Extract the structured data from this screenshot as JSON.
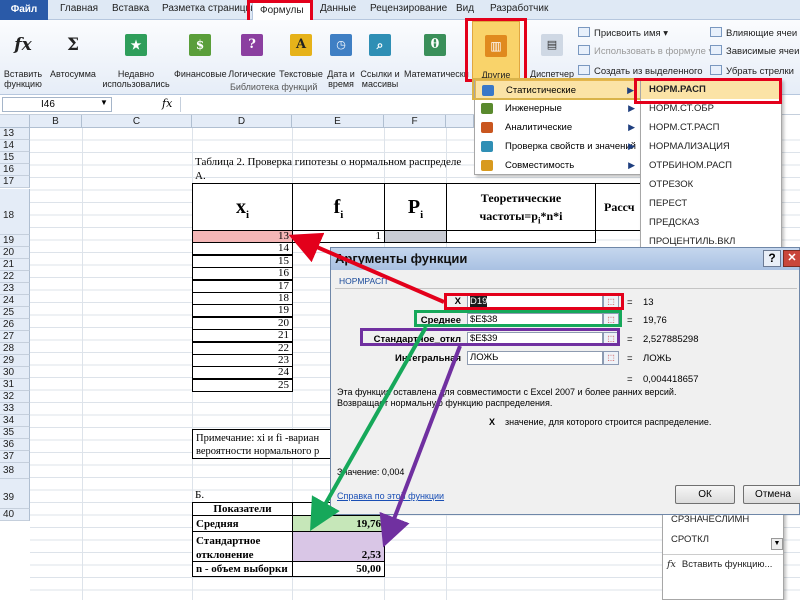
{
  "colors": {
    "accent_red": "#e3001b",
    "accent_green": "#16a85a",
    "accent_purple": "#7030a0",
    "file_tab": "#2a5aa8",
    "ribbon_bg": "#e6edf7"
  },
  "tabs": {
    "file": "Файл",
    "home": "Главная",
    "insert": "Вставка",
    "layout": "Разметка страницы",
    "formulas": "Формулы",
    "data": "Данные",
    "review": "Рецензирование",
    "view": "Вид",
    "developer": "Разработчик"
  },
  "ribbon": {
    "insert_function": "Вставить\nфункцию",
    "autosum": "Автосумма",
    "recent": "Недавно\nиспользовались",
    "financial": "Финансовые",
    "logical": "Логические",
    "text": "Текстовые",
    "datetime": "Дата и\nвремя",
    "lookup": "Ссылки и\nмассивы",
    "math": "Математически",
    "more_functions": "Другие\nфункции",
    "name_manager": "Диспетчер\nимен",
    "assign_name": "Присвоить имя",
    "use_in_formula": "Использовать в формуле",
    "create_from_selection": "Создать из выделенного",
    "trace_precedents": "Влияющие ячеи",
    "trace_dependents": "Зависимые ячеи",
    "remove_arrows": "Убрать стрелки",
    "function_library": "Библиотека функций"
  },
  "formula_bar": {
    "name_box": "I46",
    "fx": "fx"
  },
  "columns": [
    "B",
    "C",
    "D",
    "E",
    "F"
  ],
  "rows": [
    "13",
    "14",
    "15",
    "16",
    "17",
    "18",
    "19",
    "20",
    "21",
    "22",
    "23",
    "24",
    "25",
    "26",
    "27",
    "28",
    "29",
    "30",
    "31",
    "32",
    "33",
    "34",
    "35",
    "36",
    "37",
    "38",
    "39",
    "40"
  ],
  "sheet": {
    "title": "Таблица 2. Проверка гипотезы о нормальном распределе",
    "section_a": "А.",
    "hdr_x": "x",
    "hdr_x_sub": "i",
    "hdr_f": "f",
    "hdr_f_sub": "i",
    "hdr_p": "P",
    "hdr_p_sub": "i",
    "hdr_theor": "Теоретические",
    "hdr_theor2": "частоты=p",
    "hdr_theor2_tail": "*n*i",
    "hdr_theor2_sub": "i",
    "hdr_calc": "Рассч",
    "x_values": [
      "13",
      "14",
      "15",
      "16",
      "17",
      "18",
      "19",
      "20",
      "21",
      "22",
      "23",
      "24",
      "25"
    ],
    "f_first": "1",
    "note_line1": "Примечание: xi и fi -вариан",
    "note_line2": "вероятности нормального р",
    "section_b": "Б.",
    "ind_header": "Показатели",
    "mean_label": "Средняя",
    "mean_value": "19,76",
    "std_label1": "Стандартное",
    "std_label2": "отклонение",
    "std_value": "2,53",
    "n_label": "n - объем выборки",
    "n_value": "50,00"
  },
  "more_menu": {
    "statistical": "Статистические",
    "engineering": "Инженерные",
    "analytical": "Аналитические",
    "info": "Проверка свойств и значений",
    "compat": "Совместимость"
  },
  "function_list": {
    "items": [
      "НОРМ.РАСП",
      "НОРМ.СТ.ОБР",
      "НОРМ.СТ.РАСП",
      "НОРМАЛИЗАЦИЯ",
      "ОТРБИНОМ.РАСП",
      "ОТРЕЗОК",
      "ПЕРЕСТ",
      "ПРЕДСКАЗ",
      "ПРОЦЕНТИЛЬ.ВКЛ"
    ],
    "lower": [
      "СРЗНАЧЕСЛИМН",
      "СРОТКЛ"
    ],
    "insert_function": "Вставить функцию..."
  },
  "dialog": {
    "title": "Аргументы функции",
    "func_name": "НОРМРАСП",
    "arg_x_label": "X",
    "arg_x_value": "D19",
    "arg_x_result": "13",
    "arg_mean_label": "Среднее",
    "arg_mean_value": "$E$38",
    "arg_mean_result": "19,76",
    "arg_std_label": "Стандартное_откл",
    "arg_std_value": "$E$39",
    "arg_std_result": "2,527885298",
    "arg_int_label": "Интегральная",
    "arg_int_value": "ЛОЖЬ",
    "arg_int_result": "ЛОЖЬ",
    "eq": "=",
    "total_result": "0,004418657",
    "desc1": "Эта функция оставлена для совместимости с Excel 2007 и более ранних версий.",
    "desc2": "Возвращает нормальную функцию распределения.",
    "arg_help_name": "X",
    "arg_help_text": "значение, для которого строится распределение.",
    "value_text": "Значение:  0,004",
    "help_link": "Справка по этой функции",
    "ok": "ОК",
    "cancel": "Отмена"
  }
}
